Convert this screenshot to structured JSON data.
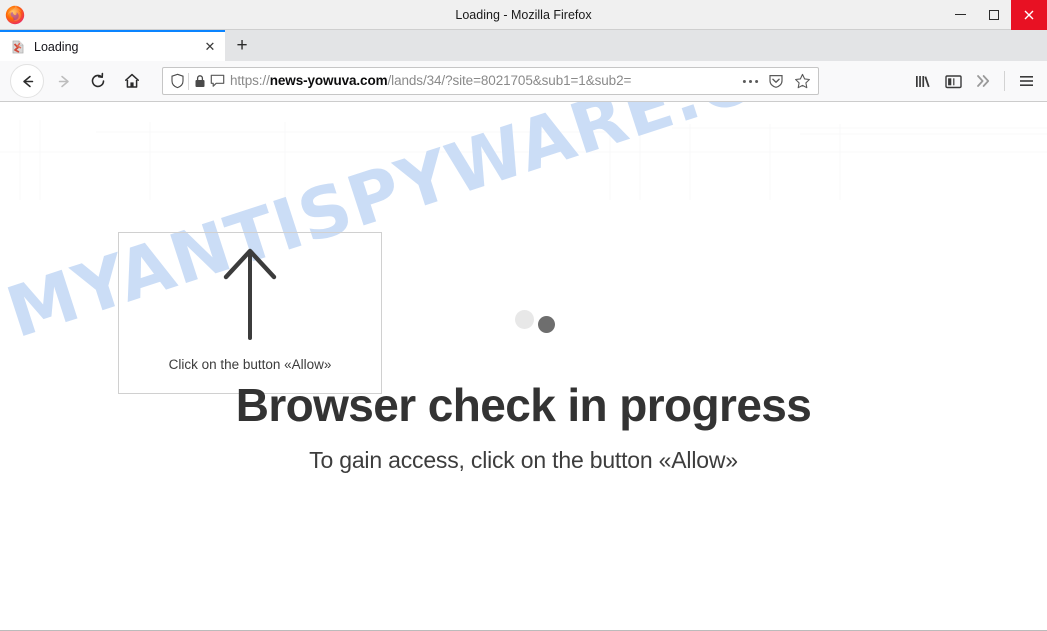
{
  "window": {
    "title": "Loading - Mozilla Firefox",
    "controls": {
      "minimize": "—",
      "maximize": "□",
      "close": "✕"
    },
    "app_icon": "firefox-logo"
  },
  "tabs": {
    "items": [
      {
        "label": "Loading",
        "favicon": "broken-page-icon",
        "close_label": "✕",
        "active": true
      }
    ],
    "new_tab_label": "+"
  },
  "toolbar": {
    "back_label": "←",
    "forward_label": "→",
    "reload_label": "⟳",
    "home_label": "⌂",
    "page_actions_label": "•••",
    "pocket_label": "pocket-icon",
    "bookmark_label": "☆",
    "library_label": "library-icon",
    "sidebar_label": "sidebar-icon",
    "overflow_label": "»",
    "menu_label": "☰"
  },
  "url": {
    "protocol": "https://",
    "host": "news-yowuva.com",
    "path": "/lands/34/?site=8021705&sub1=1&sub2=",
    "full": "https://news-yowuva.com/lands/34/?site=8021705&sub1=1&sub2=",
    "shield_icon": "tracking-protection-icon",
    "lock_icon": "padlock-icon",
    "permission_icon": "notification-permission-icon"
  },
  "page": {
    "watermark": "MYANTISPYWARE.COM",
    "hint_box": {
      "arrow": "up-arrow-icon",
      "text": "Click on the button «Allow»"
    },
    "headline": "Browser check in progress",
    "subline": "To gain access, click on the button «Allow»",
    "loader": {
      "dot_1_color": "#e8e8e8",
      "dot_2_color": "#6e6e6e"
    }
  },
  "colors": {
    "close_button": "#e81123",
    "active_tab_accent": "#0a84ff",
    "watermark": "#c9dcf6",
    "headline": "#333333"
  }
}
